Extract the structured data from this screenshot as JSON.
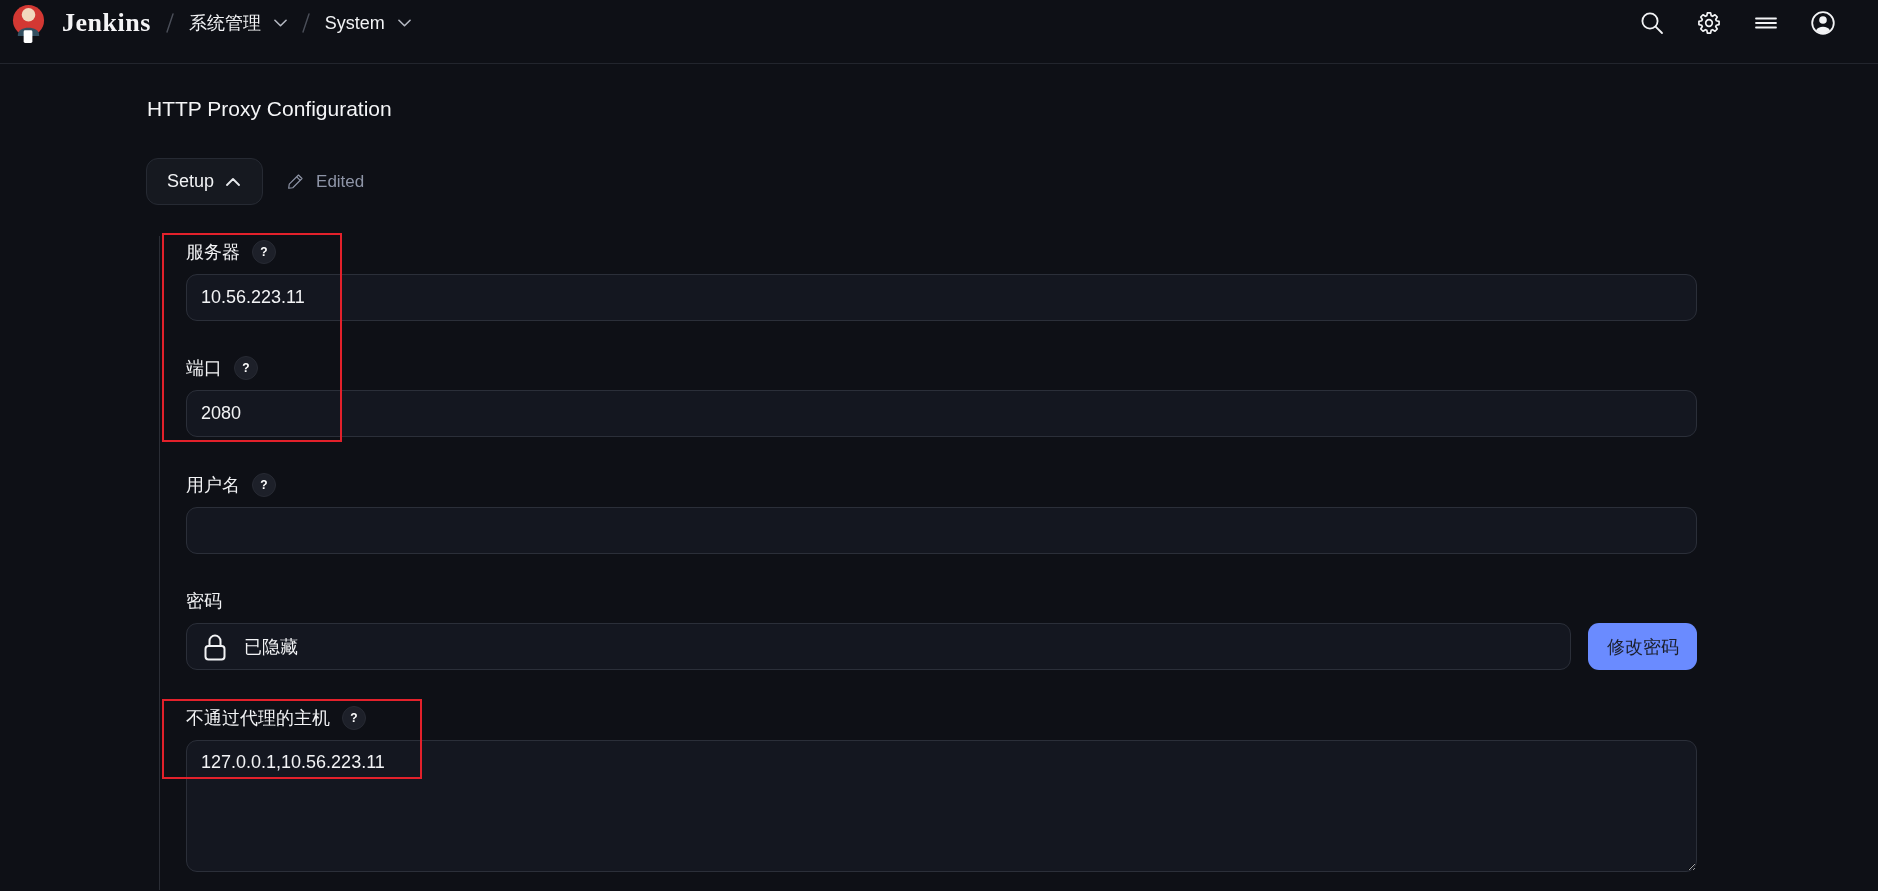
{
  "header": {
    "brand": "Jenkins",
    "breadcrumbs": [
      {
        "label": "系统管理"
      },
      {
        "label": "System"
      }
    ]
  },
  "section": {
    "title": "HTTP Proxy Configuration",
    "toggle": {
      "label": "Setup",
      "expanded": true
    },
    "status": "Edited"
  },
  "fields": [
    {
      "kind": "text",
      "label": "服务器",
      "help": "?",
      "value": "10.56.223.11",
      "highlighted": true
    },
    {
      "kind": "text",
      "label": "端口",
      "help": "?",
      "value": "2080",
      "highlighted": true
    },
    {
      "kind": "text",
      "label": "用户名",
      "help": "?",
      "highlighted": false
    },
    {
      "kind": "secret",
      "label": "密码",
      "value": "已隐藏",
      "button": "修改密码",
      "highlighted": false
    },
    {
      "kind": "textarea",
      "label": "不通过代理的主机",
      "help": "?",
      "value": "127.0.0.1,10.56.223.11",
      "highlighted": true
    }
  ]
}
